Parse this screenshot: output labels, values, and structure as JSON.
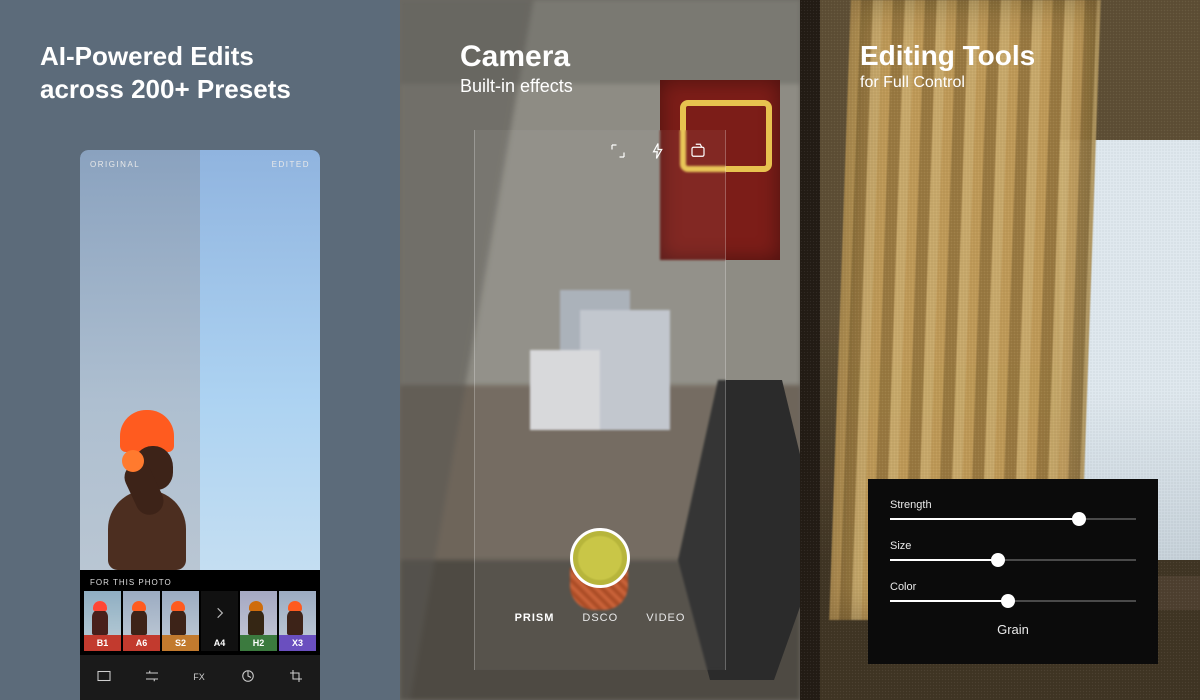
{
  "panel1": {
    "headline_l1": "AI-Powered Edits",
    "headline_l2": "across 200+ Presets",
    "compare": {
      "original": "ORIGINAL",
      "edited": "EDITED"
    },
    "for_this_photo": "FOR THIS PHOTO",
    "presets": [
      {
        "code": "B1",
        "color": "#c23a2e"
      },
      {
        "code": "A6",
        "color": "#c23a2e"
      },
      {
        "code": "S2",
        "color": "#c27a2e"
      },
      {
        "code": "A4",
        "color": "#111111"
      },
      {
        "code": "H2",
        "color": "#3b7a3e"
      },
      {
        "code": "X3",
        "color": "#6a4fbf"
      }
    ],
    "toolbar_icons": [
      "presets-icon",
      "adjust-icon",
      "fx-icon",
      "recipes-icon",
      "crop-icon"
    ]
  },
  "panel2": {
    "title": "Camera",
    "subtitle": "Built-in effects",
    "top_icons": [
      "aspect-icon",
      "flash-icon",
      "switch-camera-icon"
    ],
    "modes": {
      "items": [
        "PRISM",
        "DSCO",
        "VIDEO"
      ],
      "active": "PRISM"
    }
  },
  "panel3": {
    "title": "Editing Tools",
    "subtitle": "for Full Control",
    "tool_name": "Grain",
    "sliders": [
      {
        "label": "Strength",
        "value": 77
      },
      {
        "label": "Size",
        "value": 44
      },
      {
        "label": "Color",
        "value": 48
      }
    ]
  }
}
